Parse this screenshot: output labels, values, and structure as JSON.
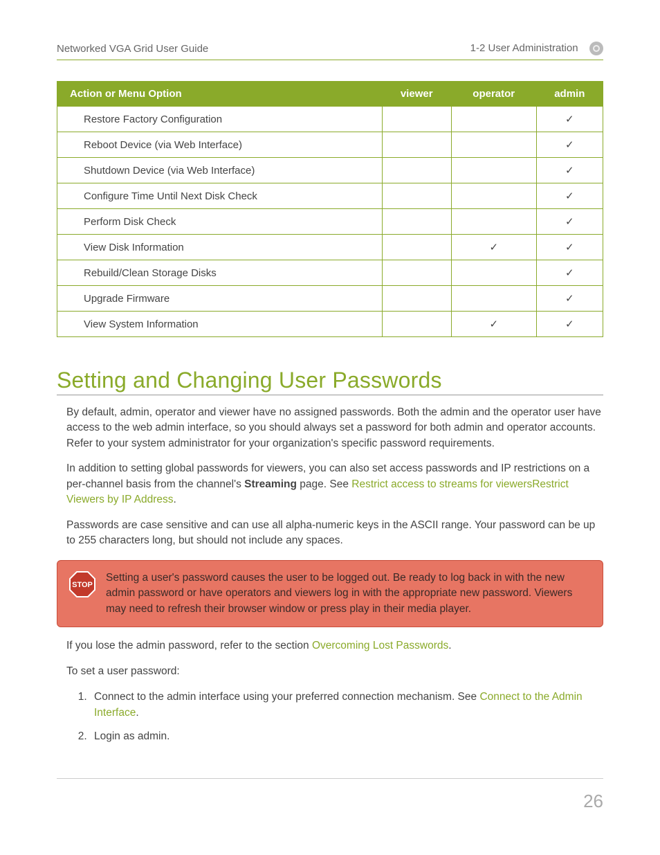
{
  "header": {
    "left": "Networked VGA Grid User Guide",
    "right": "1-2 User Administration"
  },
  "table": {
    "headers": [
      "Action or Menu Option",
      "viewer",
      "operator",
      "admin"
    ],
    "rows": [
      {
        "label": "Restore Factory Configuration",
        "viewer": "",
        "operator": "",
        "admin": "✓"
      },
      {
        "label": "Reboot Device (via Web Interface)",
        "viewer": "",
        "operator": "",
        "admin": "✓"
      },
      {
        "label": "Shutdown Device (via Web Interface)",
        "viewer": "",
        "operator": "",
        "admin": "✓"
      },
      {
        "label": "Configure Time Until Next Disk Check",
        "viewer": "",
        "operator": "",
        "admin": "✓"
      },
      {
        "label": "Perform Disk Check",
        "viewer": "",
        "operator": "",
        "admin": "✓"
      },
      {
        "label": "View Disk Information",
        "viewer": "",
        "operator": "✓",
        "admin": "✓"
      },
      {
        "label": "Rebuild/Clean Storage Disks",
        "viewer": "",
        "operator": "",
        "admin": "✓"
      },
      {
        "label": "Upgrade Firmware",
        "viewer": "",
        "operator": "",
        "admin": "✓"
      },
      {
        "label": "View System Information",
        "viewer": "",
        "operator": "✓",
        "admin": "✓"
      }
    ]
  },
  "section_title": "Setting and Changing User Passwords",
  "para1": "By default, admin, operator and viewer have no assigned passwords. Both the admin and the operator user have access to the web admin interface, so you should always set a password for both admin and operator accounts. Refer to your system administrator for your organization's specific password requirements.",
  "para2_a": "In addition to setting global passwords for viewers, you can also set access passwords and IP restrictions on a per-channel basis from the channel's ",
  "para2_bold": "Streaming",
  "para2_b": " page. See ",
  "para2_link1": "Restrict access to streams for viewers",
  "para2_link2": "Restrict Viewers by IP Address",
  "para2_c": ".",
  "para3": "Passwords are case sensitive and can use all alpha-numeric keys in the ASCII range. Your password can be up to 255 characters long, but should not include any spaces.",
  "callout": "Setting a user's password causes the user to be logged out. Be ready to log back in with the new admin password or have operators and viewers log in with the appropriate new password. Viewers may need to refresh their browser window or press play in their media player.",
  "para4_a": "If you lose the admin password, refer to the section ",
  "para4_link": "Overcoming Lost Passwords",
  "para4_b": ".",
  "para5": "To set a user password:",
  "steps": {
    "s1_a": "Connect to the admin interface using your preferred connection mechanism. See ",
    "s1_link": "Connect to the Admin Interface",
    "s1_b": ".",
    "s2": "Login as admin."
  },
  "page_number": "26",
  "stop_label": "STOP"
}
